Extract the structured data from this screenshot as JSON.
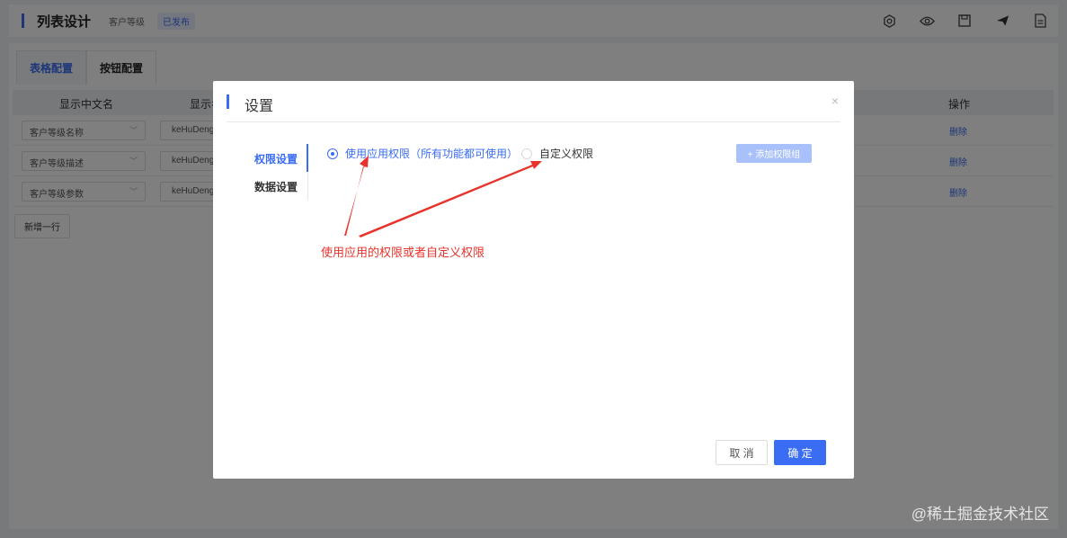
{
  "app": {
    "title": "列表设计",
    "subtitle": "客户等级",
    "status": "已发布",
    "icons": [
      "settings-icon",
      "eye-icon",
      "save-icon",
      "send-icon",
      "document-icon"
    ]
  },
  "tabs": [
    "表格配置",
    "按钮配置"
  ],
  "table": {
    "headers": [
      "显示中文名",
      "显示名",
      "操作"
    ],
    "rows": [
      {
        "name": "客户等级名称",
        "field": "keHuDeng",
        "action": "删除"
      },
      {
        "name": "客户等级描述",
        "field": "keHuDeng",
        "action": "删除"
      },
      {
        "name": "客户等级参数",
        "field": "keHuDeng",
        "action": "删除"
      }
    ],
    "add_row": "新增一行"
  },
  "modal": {
    "title": "设置",
    "close": "×",
    "nav": [
      "权限设置",
      "数据设置"
    ],
    "radio_app": "使用应用权限（所有功能都可使用）",
    "radio_custom": "自定义权限",
    "add_group": "+ 添加权限组",
    "annotation": "使用应用的权限或者自定义权限",
    "cancel": "取 消",
    "confirm": "确 定"
  },
  "watermark": "@稀土掘金技术社区",
  "colors": {
    "accent": "#3a6cf4",
    "annotation": "#e8332b"
  }
}
